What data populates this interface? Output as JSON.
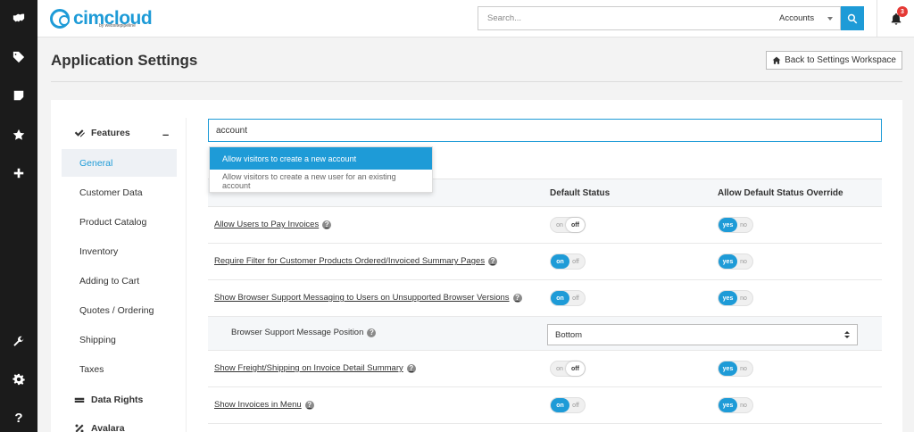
{
  "app": {
    "logo_text": "cimcloud",
    "logo_sub": "by websitepipeline"
  },
  "topbar": {
    "search_placeholder": "Search...",
    "search_scope": "Accounts",
    "notification_count": "3"
  },
  "rail": {
    "icons": [
      "handshake-icon",
      "tag-icon",
      "sticky-note-icon",
      "star-icon",
      "plus-icon",
      "wrench-icon",
      "gear-icon",
      "question-icon"
    ]
  },
  "header": {
    "title": "Application Settings",
    "back_label": "Back to Settings Workspace"
  },
  "subnav": {
    "features_label": "Features",
    "collapse_symbol": "–",
    "items": [
      "General",
      "Customer Data",
      "Product Catalog",
      "Inventory",
      "Adding to Cart",
      "Quotes / Ordering",
      "Shipping",
      "Taxes"
    ],
    "active_item": "General",
    "data_rights_label": "Data Rights",
    "avalara_label": "Avalara"
  },
  "filter": {
    "value": "account"
  },
  "autocomplete": {
    "items": [
      "Allow visitors to create a new account",
      "Allow visitors to create a new user for an existing account"
    ]
  },
  "table": {
    "col_default_status": "Default Status",
    "col_override": "Allow Default Status Override",
    "toggle_on": "on",
    "toggle_off": "off",
    "toggle_yes": "yes",
    "toggle_no": "no",
    "rows": [
      {
        "label": "Allow Users to Pay Invoices",
        "status": "off",
        "override": "yes"
      },
      {
        "label": "Require Filter for Customer Products Ordered/Invoiced Summary Pages",
        "status": "on",
        "override": "yes"
      },
      {
        "label": "Show Browser Support Messaging to Users on Unsupported Browser Versions",
        "status": "on",
        "override": "yes"
      },
      {
        "label": "Browser Support Message Position",
        "select_value": "Bottom"
      },
      {
        "label": "Show Freight/Shipping on Invoice Detail Summary",
        "status": "off",
        "override": "yes"
      },
      {
        "label": "Show Invoices in Menu",
        "status": "on",
        "override": "yes"
      }
    ]
  },
  "colors": {
    "accent": "#1e9bd7",
    "rail": "#1b1b1b",
    "badge": "#e53935"
  }
}
